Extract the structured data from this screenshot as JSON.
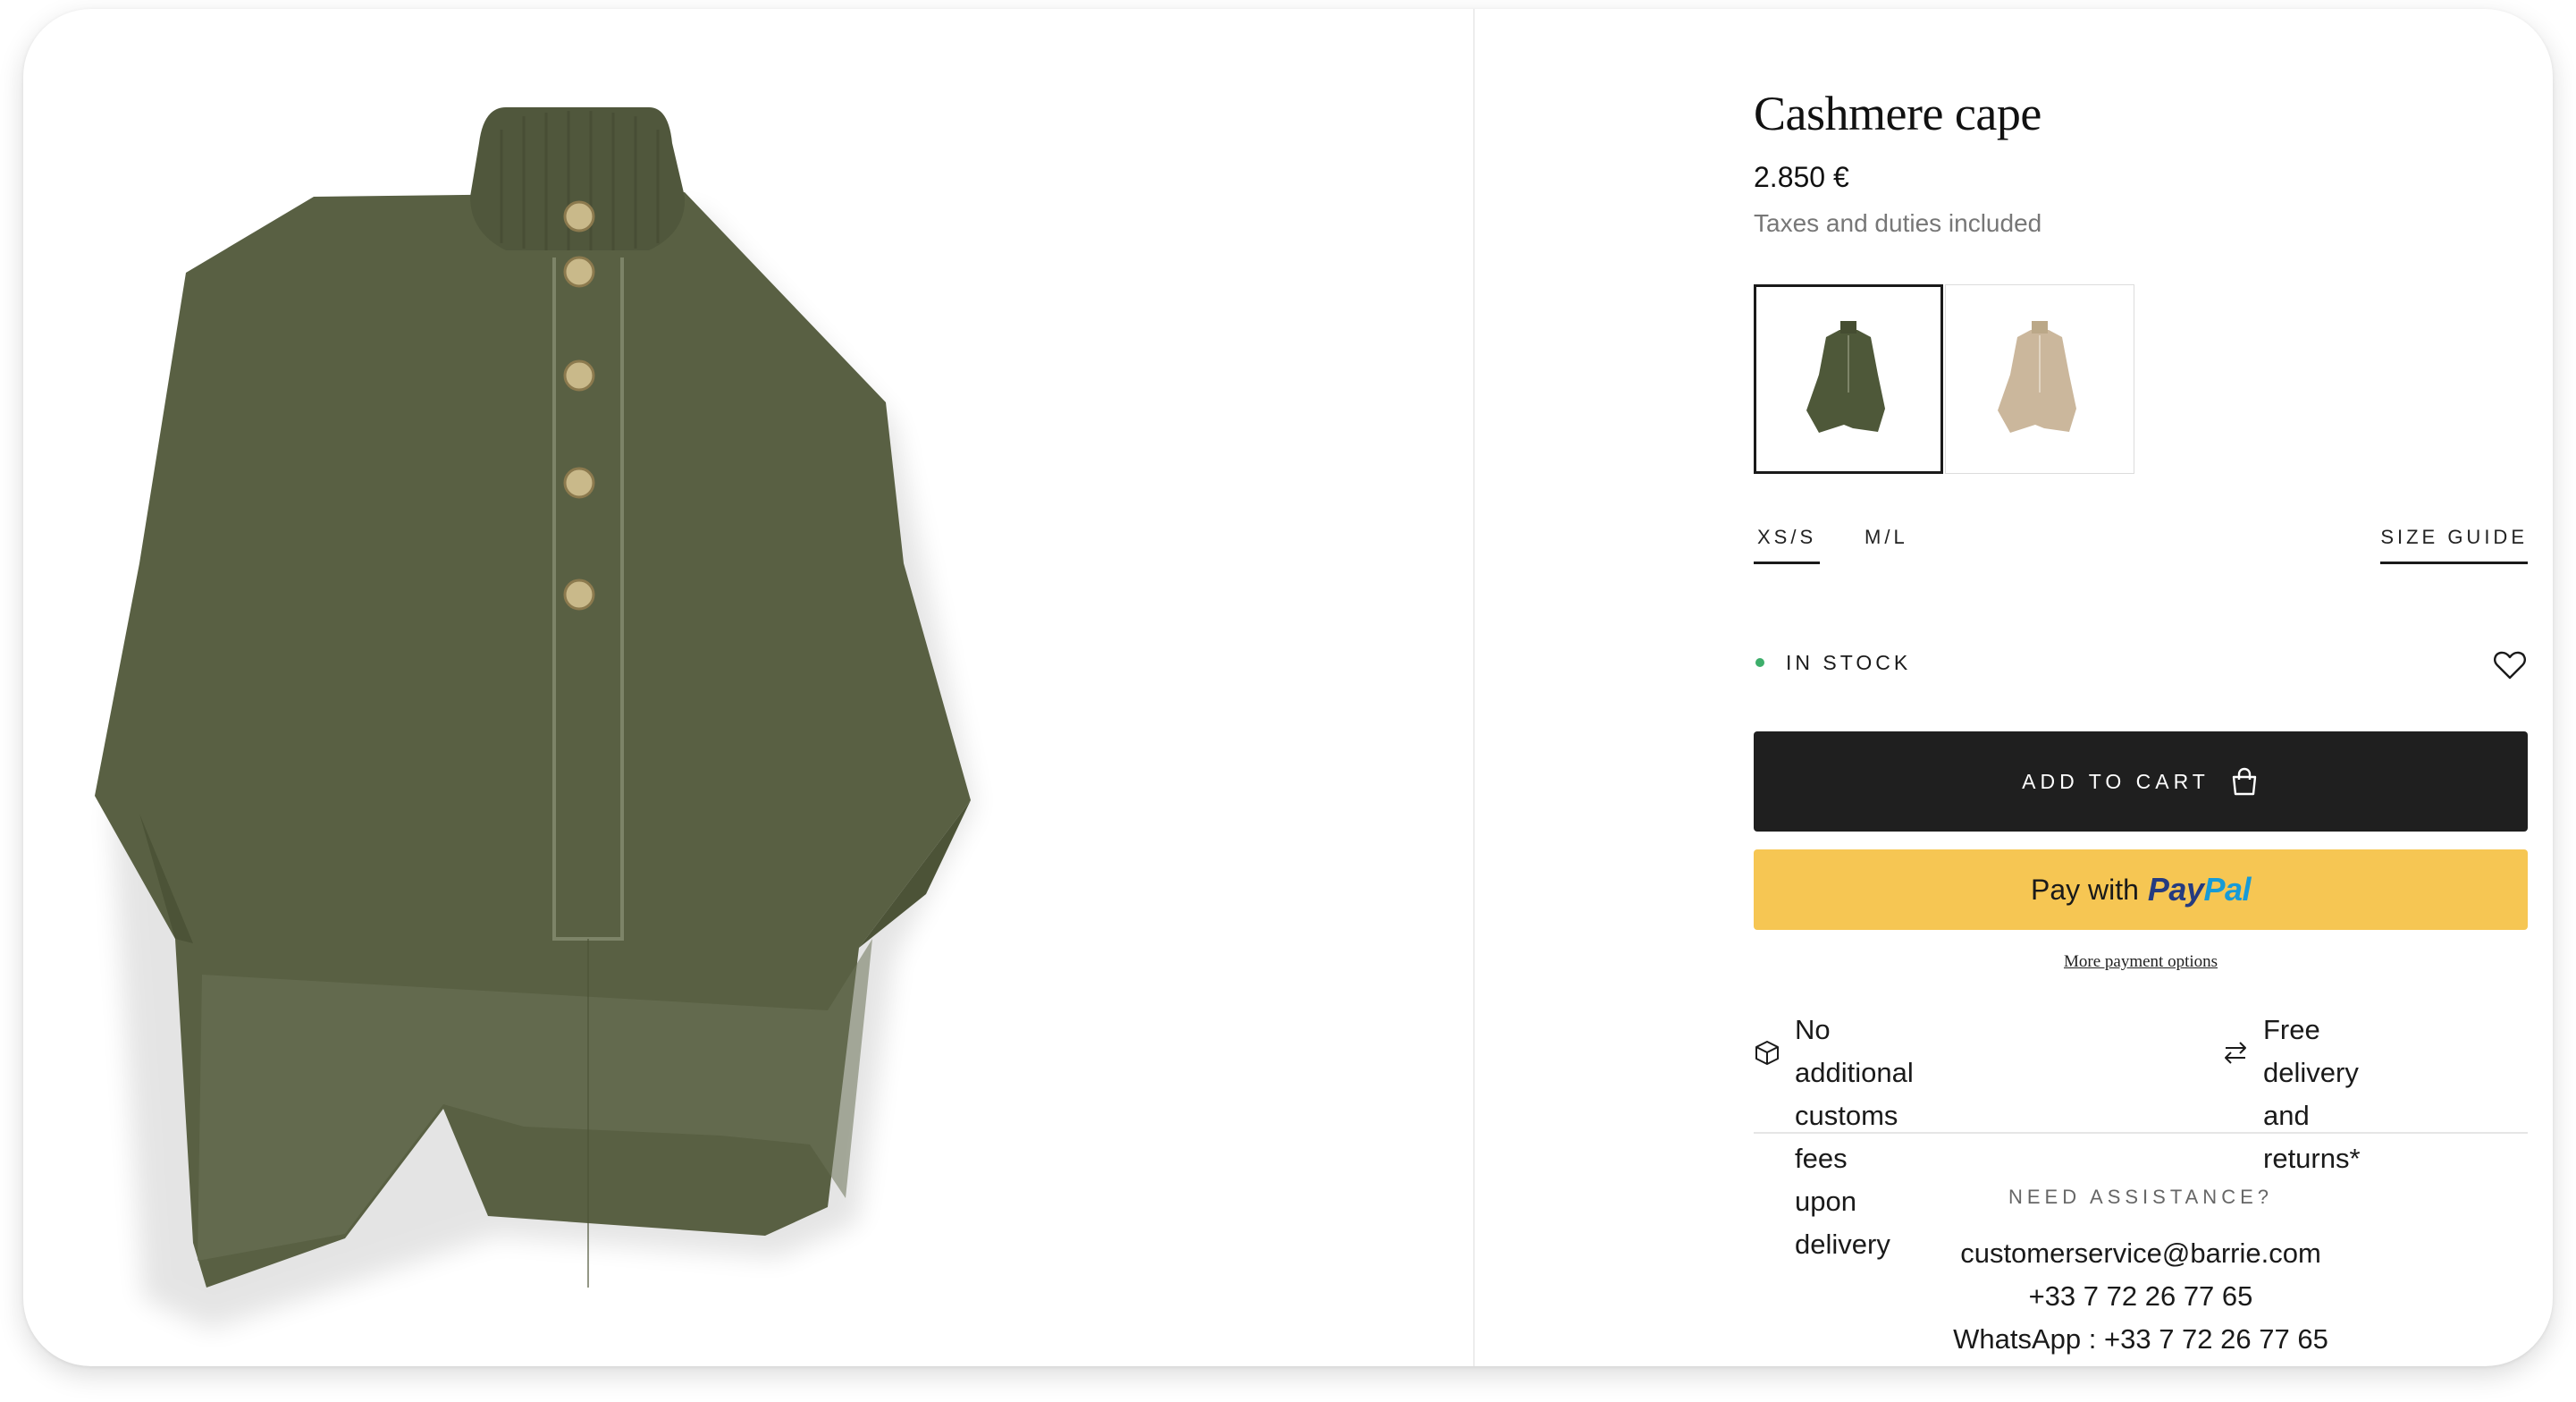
{
  "product": {
    "title": "Cashmere cape",
    "price": "2.850 €",
    "tax_note": "Taxes and duties included",
    "image_icon": "green-cashmere-cape-image"
  },
  "colors": {
    "accent_dark": "#1f1f1f",
    "paypal_yellow": "#f6c653",
    "in_stock_green": "#3dae6b",
    "variants": [
      {
        "icon": "green-cape-swatch",
        "color": "#4e5839",
        "selected": true
      },
      {
        "icon": "beige-cape-swatch",
        "color": "#cbb79c",
        "selected": false
      }
    ]
  },
  "sizes": {
    "options": [
      "XS/S",
      "M/L"
    ],
    "selected": "XS/S",
    "size_guide_label": "SIZE GUIDE"
  },
  "stock": {
    "label": "IN STOCK",
    "wishlist_icon": "heart-icon"
  },
  "cart": {
    "add_label": "ADD TO CART",
    "icon": "shopping-bag-icon"
  },
  "paypal": {
    "prefix": "Pay with",
    "brand_a": "Pay",
    "brand_b": "Pal"
  },
  "more_payment": "More payment options",
  "features": [
    {
      "icon": "box-icon",
      "line1": "No additional customs fees upon",
      "line2": "delivery"
    },
    {
      "icon": "exchange-arrows-icon",
      "line1": "Free delivery and",
      "line2": "returns*"
    }
  ],
  "assistance": {
    "title": "NEED ASSISTANCE?",
    "email": "customerservice@barrie.com",
    "phone": "+33 7 72 26 77 65",
    "whatsapp": "WhatsApp : +33 7 72 26 77 65"
  }
}
